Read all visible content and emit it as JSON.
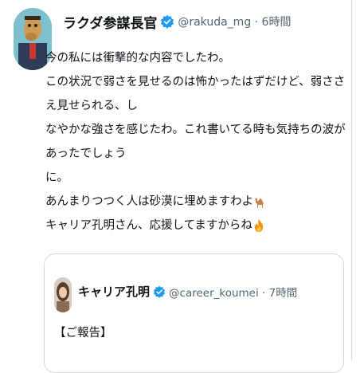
{
  "tweet": {
    "author_name": "ラクダ参謀長官",
    "handle_time": "@rakuda_mg · 6時間",
    "lines": [
      "今の私には衝撃的な内容でしたわ。",
      "この状況で弱さを見せるのは怖かったはずだけど、弱ささえ見せられる、し",
      "なやかな強さを感じたわ。これ書いてる時も気持ちの波があったでしょう",
      "に。",
      "あんまりつつく人は砂漠に埋めますわよ",
      "キャリア孔明さん、応援してますからね"
    ],
    "emoji_camel": "camel-emoji",
    "emoji_fire": "fire-emoji"
  },
  "quote": {
    "author_name": "キャリア孔明",
    "handle_time": "@career_koumei · 7時間",
    "lines": [
      "【ご報告】"
    ]
  },
  "colors": {
    "verified": "#1d9bf0",
    "text": "#0f1419",
    "muted": "#536471",
    "border": "#cfd9de"
  }
}
